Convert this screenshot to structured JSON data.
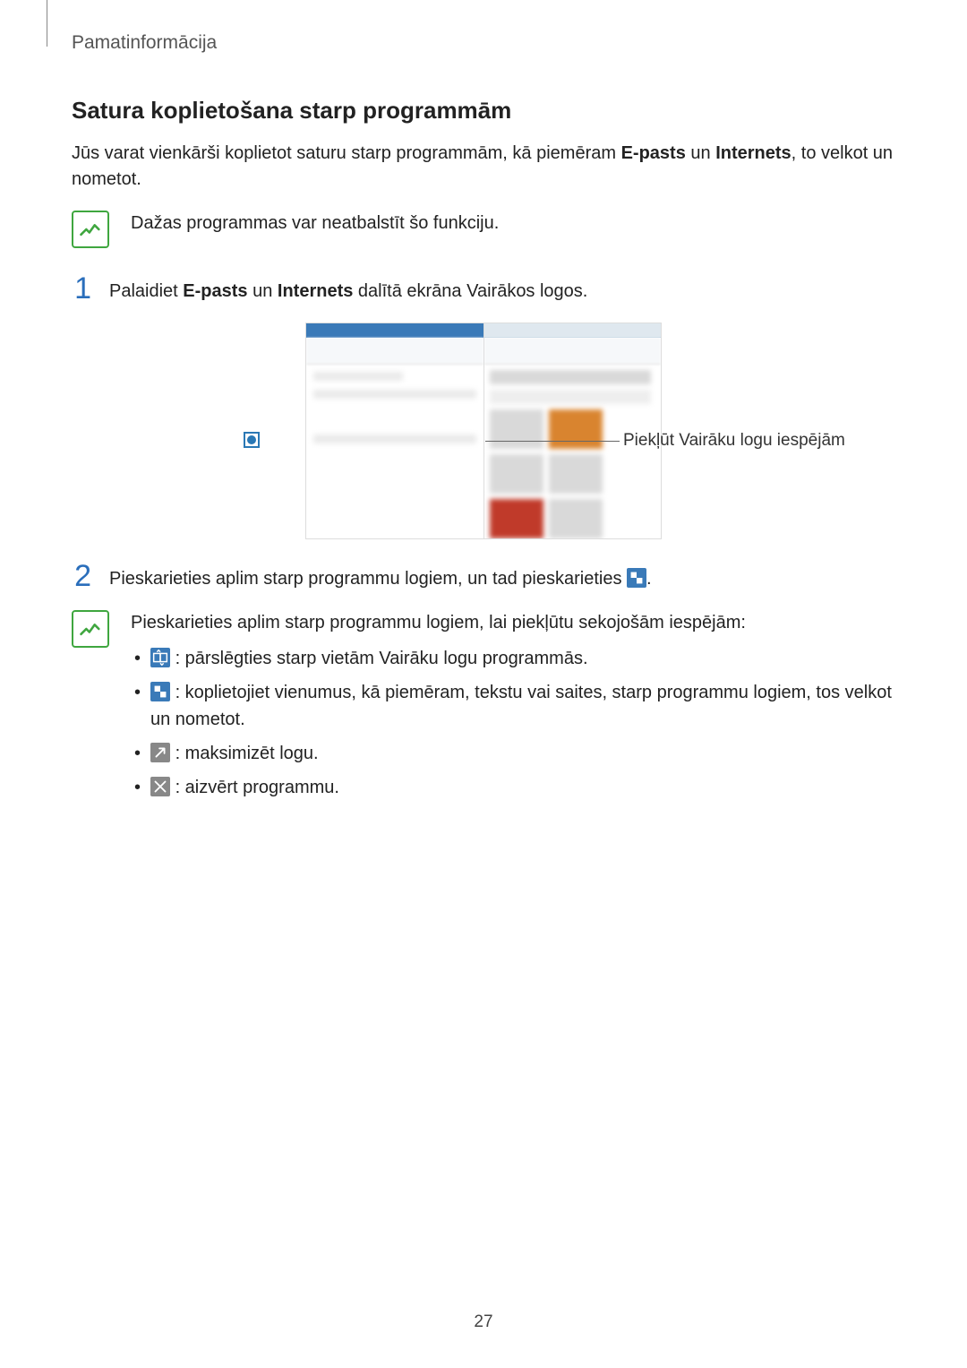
{
  "section": "Pamatinformācija",
  "heading": "Satura koplietošana starp programmām",
  "intro": {
    "pre": "Jūs varat vienkārši koplietot saturu starp programmām, kā piemēram ",
    "b1": "E-pasts",
    "mid": " un ",
    "b2": "Internets",
    "post": ", to velkot un nometot."
  },
  "note1": "Dažas programmas var neatbalstīt šo funkciju.",
  "step1": {
    "num": "1",
    "pre": "Palaidiet ",
    "b1": "E-pasts",
    "mid": " un ",
    "b2": "Internets",
    "post": " dalītā ekrāna Vairākos logos."
  },
  "callout": "Piekļūt Vairāku logu iespējām",
  "step2": {
    "num": "2",
    "pre": "Pieskarieties aplim starp programmu logiem, un tad pieskarieties ",
    "post": "."
  },
  "note2_intro": "Pieskarieties aplim starp programmu logiem, lai piekļūtu sekojošām iespējām:",
  "bullets": [
    ": pārslēgties starp vietām Vairāku logu programmās.",
    ": koplietojiet vienumus, kā piemēram, tekstu vai saites, starp programmu logiem, tos velkot un nometot.",
    ": maksimizēt logu.",
    ": aizvērt programmu."
  ],
  "page": "27"
}
